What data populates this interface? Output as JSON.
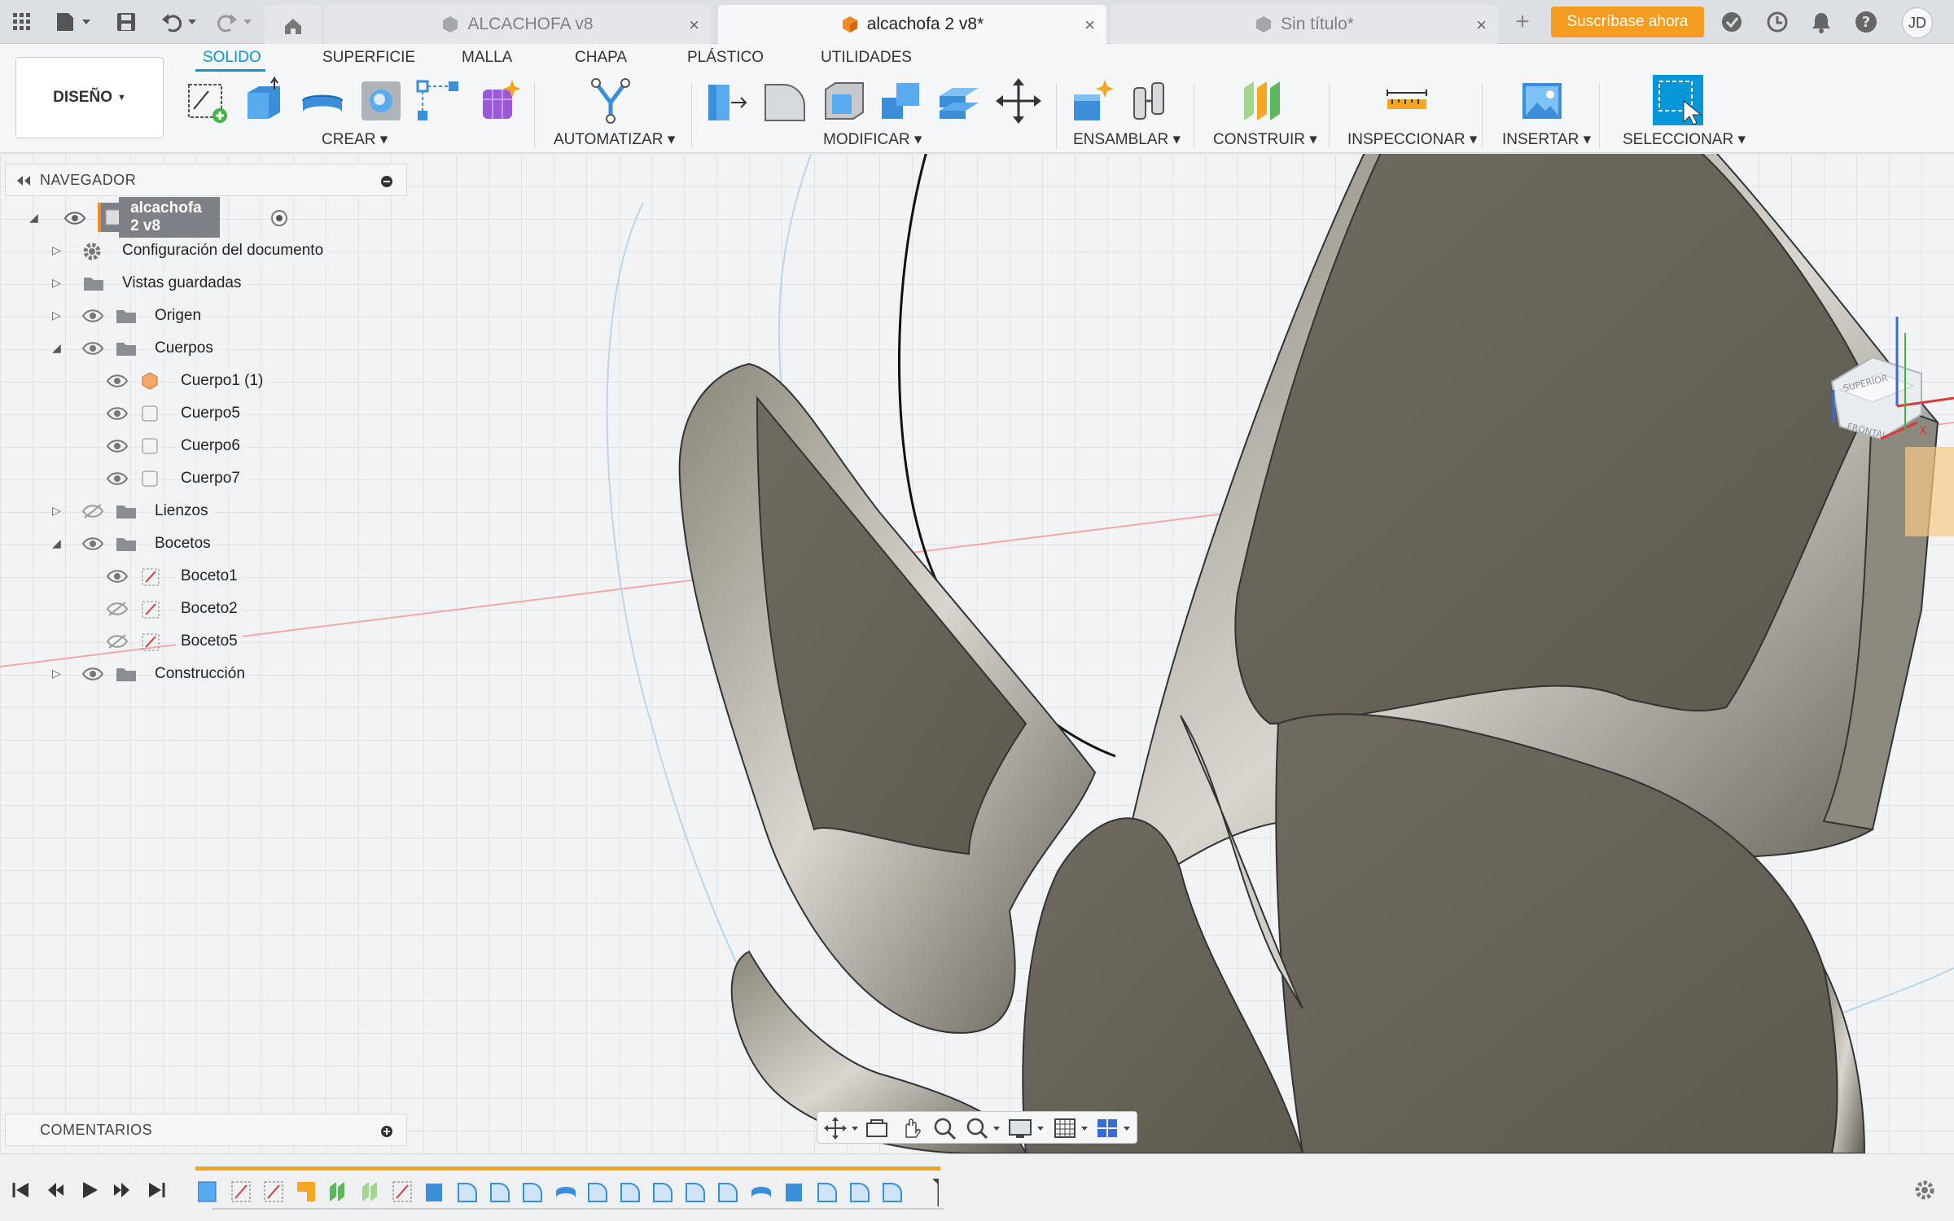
{
  "tabs": [
    {
      "label": "ALCACHOFA v8",
      "close": "×"
    },
    {
      "label": "alcachofa 2 v8*",
      "close": "×"
    },
    {
      "label": "Sin título*",
      "close": "×"
    }
  ],
  "topbar": {
    "subscribe_label": "Suscríbase ahora",
    "avatar_initials": "JD",
    "add_tab": "+"
  },
  "workspace": {
    "mode_label": "DISEÑO",
    "tabs": [
      "SOLIDO",
      "SUPERFICIE",
      "MALLA",
      "CHAPA",
      "PLÁSTICO",
      "UTILIDADES"
    ],
    "active_tab": "SOLIDO"
  },
  "tool_groups": {
    "crear": "CREAR",
    "automatizar": "AUTOMATIZAR",
    "modificar": "MODIFICAR",
    "ensamblar": "ENSAMBLAR",
    "construir": "CONSTRUIR",
    "inspeccionar": "INSPECCIONAR",
    "insertar": "INSERTAR",
    "seleccionar": "SELECCIONAR"
  },
  "browser": {
    "title": "NAVEGADOR",
    "root": "alcachofa 2 v8",
    "items": [
      {
        "label": "Configuración del documento"
      },
      {
        "label": "Vistas guardadas"
      },
      {
        "label": "Origen"
      },
      {
        "label": "Cuerpos"
      },
      {
        "label": "Cuerpo1 (1)"
      },
      {
        "label": "Cuerpo5"
      },
      {
        "label": "Cuerpo6"
      },
      {
        "label": "Cuerpo7"
      },
      {
        "label": "Lienzos"
      },
      {
        "label": "Bocetos"
      },
      {
        "label": "Boceto1"
      },
      {
        "label": "Boceto2"
      },
      {
        "label": "Boceto5"
      },
      {
        "label": "Construcción"
      }
    ]
  },
  "comments": {
    "title": "COMENTARIOS"
  },
  "viewcube": {
    "top": "SUPERIOR",
    "front": "FRONTAL",
    "x_axis": "X"
  },
  "colors": {
    "accent": "#0696d7",
    "subscribe": "#f39c22",
    "model": "#6e6a5f",
    "timeline_bar": "#f5a623"
  }
}
